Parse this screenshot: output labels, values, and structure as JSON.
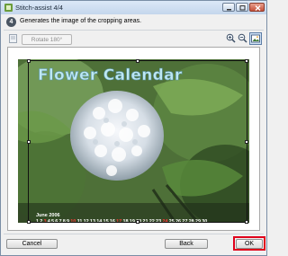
{
  "window": {
    "title": "Stitch-assist 4/4",
    "minimize": "minimize",
    "maximize": "maximize",
    "close": "close"
  },
  "step": {
    "number": "4",
    "instruction": "Generates the image of the cropping areas."
  },
  "toolbar": {
    "rotate_label": "Rotate 180°",
    "zoom_in": "zoom-in-icon",
    "zoom_out": "zoom-out-icon",
    "fit": "fit-to-window-icon"
  },
  "image": {
    "title": "Flower Calendar",
    "month": "June 2006",
    "days": [
      "1",
      "2",
      "3",
      "4",
      "5",
      "6",
      "7",
      "8",
      "9",
      "10",
      "11",
      "12",
      "13",
      "14",
      "15",
      "16",
      "17",
      "18",
      "19",
      "20",
      "21",
      "22",
      "23",
      "24",
      "25",
      "26",
      "27",
      "28",
      "29",
      "30"
    ],
    "sunday_color": "#ff3b3b"
  },
  "buttons": {
    "cancel": "Cancel",
    "back": "Back",
    "ok": "OK"
  },
  "colors": {
    "highlight": "#e0001b",
    "title_bar": "#c4d6ec"
  }
}
